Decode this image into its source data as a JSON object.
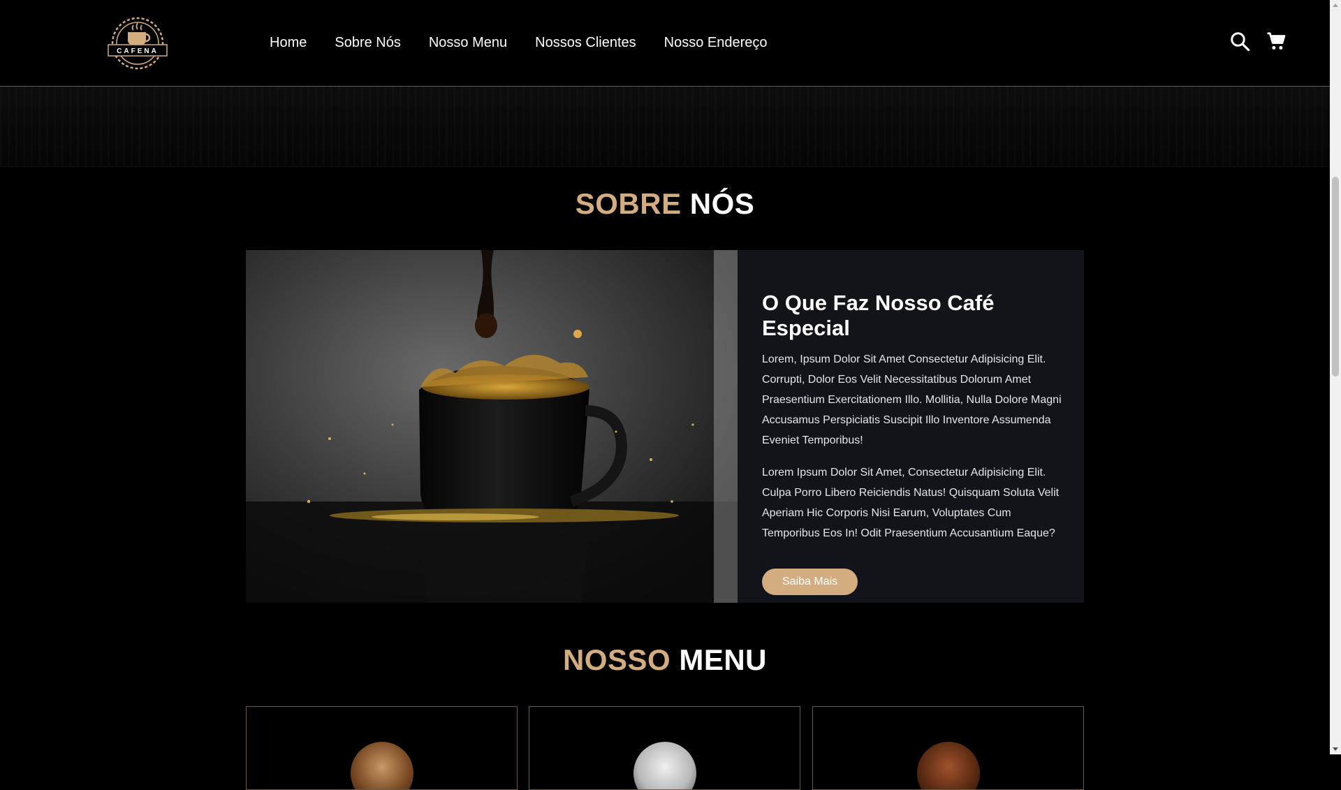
{
  "brand": {
    "logo_text": "CAFENA"
  },
  "nav": {
    "items": [
      {
        "label": "Home"
      },
      {
        "label": "Sobre Nós"
      },
      {
        "label": "Nosso Menu"
      },
      {
        "label": "Nossos Clientes"
      },
      {
        "label": "Nosso Endereço"
      }
    ]
  },
  "header_icons": {
    "search": "search-icon",
    "cart": "shopping-cart-icon"
  },
  "about": {
    "heading_accent": "SOBRE",
    "heading_main": "NÓS",
    "title": "O Que Faz Nosso Café Especial",
    "paragraphs": [
      "Lorem, Ipsum Dolor Sit Amet Consectetur Adipisicing Elit. Corrupti, Dolor Eos Velit Necessitatibus Dolorum Amet Praesentium Exercitationem Illo. Mollitia, Nulla Dolore Magni Accusamus Perspiciatis Suscipit Illo Inventore Assumenda Eveniet Temporibus!",
      "Lorem Ipsum Dolor Sit Amet, Consectetur Adipisicing Elit. Culpa Porro Libero Reiciendis Natus! Quisquam Soluta Velit Aperiam Hic Corporis Nisi Earum, Voluptates Cum Temporibus Eos In! Odit Praesentium Accusantium Eaque?"
    ],
    "button_label": "Saiba Mais"
  },
  "menu": {
    "heading_accent": "NOSSO",
    "heading_main": "MENU"
  },
  "colors": {
    "accent": "#d3ad7f",
    "background": "#000000",
    "card_background": "#13131a",
    "border": "#6b5a45"
  }
}
